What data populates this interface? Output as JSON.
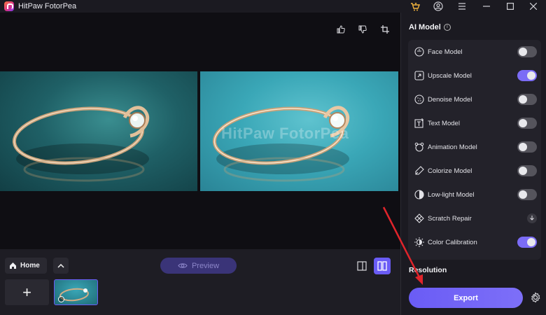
{
  "app": {
    "title": "HitPaw FotorPea"
  },
  "canvas": {
    "watermark": "HitPaw FotorPea"
  },
  "bottom": {
    "home_label": "Home",
    "preview_label": "Preview",
    "add_label": "+"
  },
  "panel": {
    "title": "AI Model",
    "models": [
      {
        "label": "Face Model",
        "icon": "face-icon",
        "state": "off"
      },
      {
        "label": "Upscale Model",
        "icon": "upscale-icon",
        "state": "on"
      },
      {
        "label": "Denoise Model",
        "icon": "denoise-icon",
        "state": "off"
      },
      {
        "label": "Text Model",
        "icon": "text-icon",
        "state": "off"
      },
      {
        "label": "Animation Model",
        "icon": "animation-icon",
        "state": "off"
      },
      {
        "label": "Colorize Model",
        "icon": "colorize-icon",
        "state": "off"
      },
      {
        "label": "Low-light Model",
        "icon": "low-light-icon",
        "state": "off"
      },
      {
        "label": "Scratch Repair",
        "icon": "scratch-icon",
        "state": "download"
      },
      {
        "label": "Color Calibration",
        "icon": "color-calibration-icon",
        "state": "on"
      }
    ],
    "resolution_label": "Resolution",
    "export_label": "Export"
  },
  "colors": {
    "accent": "#6a5cf5",
    "annotation": "#e0242b"
  }
}
